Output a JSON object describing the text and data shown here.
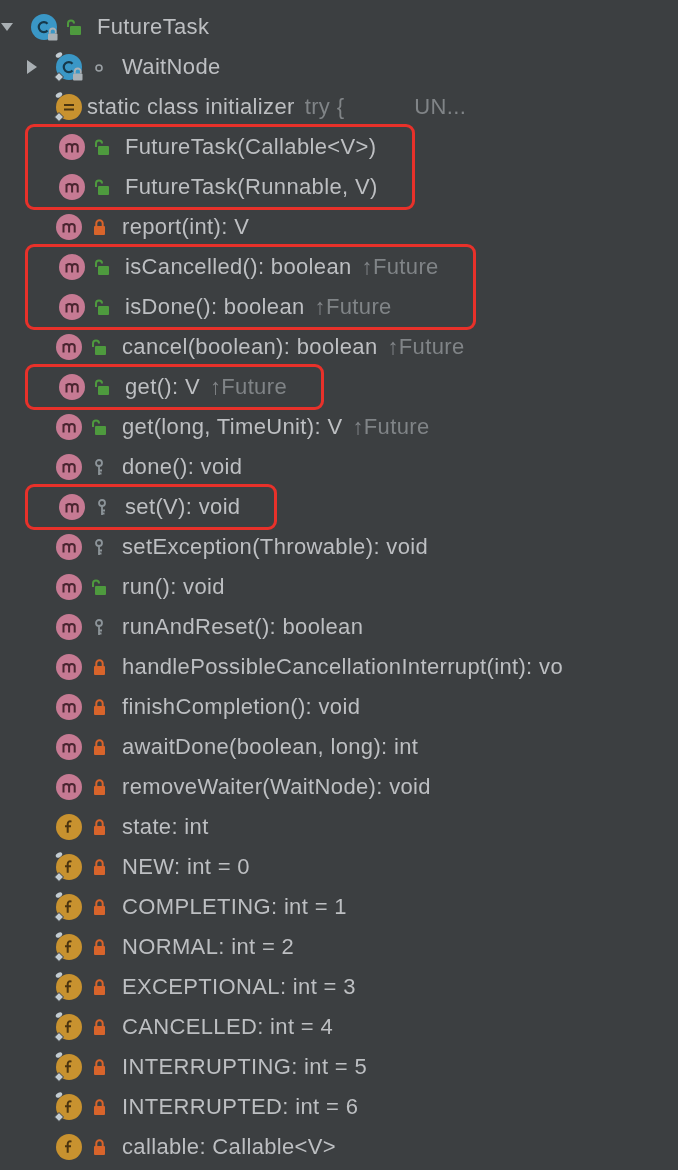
{
  "tree": {
    "kind": "class",
    "access": {
      "kind": "public"
    },
    "read_only": true,
    "static": false,
    "name": "FutureTask",
    "expanded": true,
    "children": [
      {
        "kind": "class",
        "access": {
          "kind": "package"
        },
        "read_only": true,
        "static": true,
        "name": "WaitNode",
        "expanded": false
      },
      {
        "kind": "initializer",
        "static": true,
        "name": "static class initializer",
        "snippet": "try {",
        "trailing": "UN..."
      },
      {
        "kind": "method",
        "access": {
          "kind": "public"
        },
        "name": "FutureTask(Callable<V>)",
        "highlighted": true
      },
      {
        "kind": "method",
        "access": {
          "kind": "public"
        },
        "name": "FutureTask(Runnable, V)",
        "highlighted": true
      },
      {
        "kind": "method",
        "access": {
          "kind": "private"
        },
        "name": "report(int): V",
        "highlighted": false
      },
      {
        "kind": "method",
        "access": {
          "kind": "public"
        },
        "name": "isCancelled(): boolean",
        "origin": "↑Future",
        "highlighted": true
      },
      {
        "kind": "method",
        "access": {
          "kind": "public"
        },
        "name": "isDone(): boolean",
        "origin": "↑Future",
        "highlighted": true
      },
      {
        "kind": "method",
        "access": {
          "kind": "public"
        },
        "name": "cancel(boolean): boolean",
        "origin": "↑Future",
        "highlighted": false
      },
      {
        "kind": "method",
        "access": {
          "kind": "public"
        },
        "name": "get(): V",
        "origin": "↑Future",
        "highlighted": true
      },
      {
        "kind": "method",
        "access": {
          "kind": "public"
        },
        "name": "get(long, TimeUnit): V",
        "origin": "↑Future",
        "highlighted": false
      },
      {
        "kind": "method",
        "access": {
          "kind": "protected"
        },
        "name": "done(): void",
        "highlighted": false
      },
      {
        "kind": "method",
        "access": {
          "kind": "protected"
        },
        "name": "set(V): void",
        "highlighted": true
      },
      {
        "kind": "method",
        "access": {
          "kind": "protected"
        },
        "name": "setException(Throwable): void",
        "highlighted": false
      },
      {
        "kind": "method",
        "access": {
          "kind": "public"
        },
        "name": "run(): void",
        "highlighted": false
      },
      {
        "kind": "method",
        "access": {
          "kind": "protected"
        },
        "name": "runAndReset(): boolean",
        "highlighted": false
      },
      {
        "kind": "method",
        "access": {
          "kind": "private"
        },
        "name": "handlePossibleCancellationInterrupt(int): vo",
        "highlighted": false
      },
      {
        "kind": "method",
        "access": {
          "kind": "private"
        },
        "name": "finishCompletion(): void",
        "highlighted": false
      },
      {
        "kind": "method",
        "access": {
          "kind": "private"
        },
        "name": "awaitDone(boolean, long): int",
        "highlighted": false
      },
      {
        "kind": "method",
        "access": {
          "kind": "private"
        },
        "name": "removeWaiter(WaitNode): void",
        "highlighted": false
      },
      {
        "kind": "field",
        "access": {
          "kind": "private"
        },
        "static": false,
        "name": "state: int",
        "highlighted": false
      },
      {
        "kind": "field",
        "access": {
          "kind": "private"
        },
        "static": true,
        "name": "NEW: int = 0",
        "highlighted": false
      },
      {
        "kind": "field",
        "access": {
          "kind": "private"
        },
        "static": true,
        "name": "COMPLETING: int = 1",
        "highlighted": false
      },
      {
        "kind": "field",
        "access": {
          "kind": "private"
        },
        "static": true,
        "name": "NORMAL: int = 2",
        "highlighted": false
      },
      {
        "kind": "field",
        "access": {
          "kind": "private"
        },
        "static": true,
        "name": "EXCEPTIONAL: int = 3",
        "highlighted": false
      },
      {
        "kind": "field",
        "access": {
          "kind": "private"
        },
        "static": true,
        "name": "CANCELLED: int = 4",
        "highlighted": false
      },
      {
        "kind": "field",
        "access": {
          "kind": "private"
        },
        "static": true,
        "name": "INTERRUPTING: int = 5",
        "highlighted": false
      },
      {
        "kind": "field",
        "access": {
          "kind": "private"
        },
        "static": true,
        "name": "INTERRUPTED: int = 6",
        "highlighted": false
      },
      {
        "kind": "field",
        "access": {
          "kind": "private"
        },
        "static": false,
        "name": "callable: Callable<V>",
        "highlighted": false
      }
    ]
  }
}
